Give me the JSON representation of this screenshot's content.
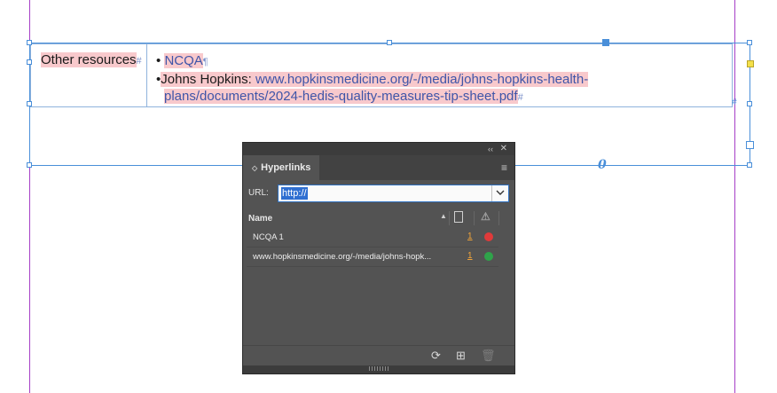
{
  "document": {
    "cell1_text": "Other resources",
    "cell1_marker": "#",
    "bullet1_link": "NCQA",
    "pilcrow": "¶",
    "bullet2_label": "Johns Hopkins: ",
    "bullet2_link": "www.hopkinsmedicine.org/-/media/johns-hopkins-health-plans/documents/2024-hedis-quality-measures-tip-sheet.pdf",
    "end_marker": "#",
    "overset_marker": "0",
    "hl_color": "#f8c9cc",
    "link_color": "#3f55a8"
  },
  "panel": {
    "collapse_glyph": "‹‹",
    "close_glyph": "✕",
    "tab_label": "Hyperlinks",
    "menu_glyph": "≡",
    "url_label": "URL:",
    "url_value": "http://",
    "header_name": "Name",
    "rows": [
      {
        "name": "NCQA 1",
        "page": "1",
        "status_color": "#e03a3a"
      },
      {
        "name": "www.hopkinsmedicine.org/-/media/johns-hopk...",
        "page": "1",
        "status_color": "#2fa34a"
      }
    ],
    "icons": {
      "refresh": "refresh-icon",
      "new": "new-hyperlink-icon",
      "delete": "trash-icon"
    }
  }
}
